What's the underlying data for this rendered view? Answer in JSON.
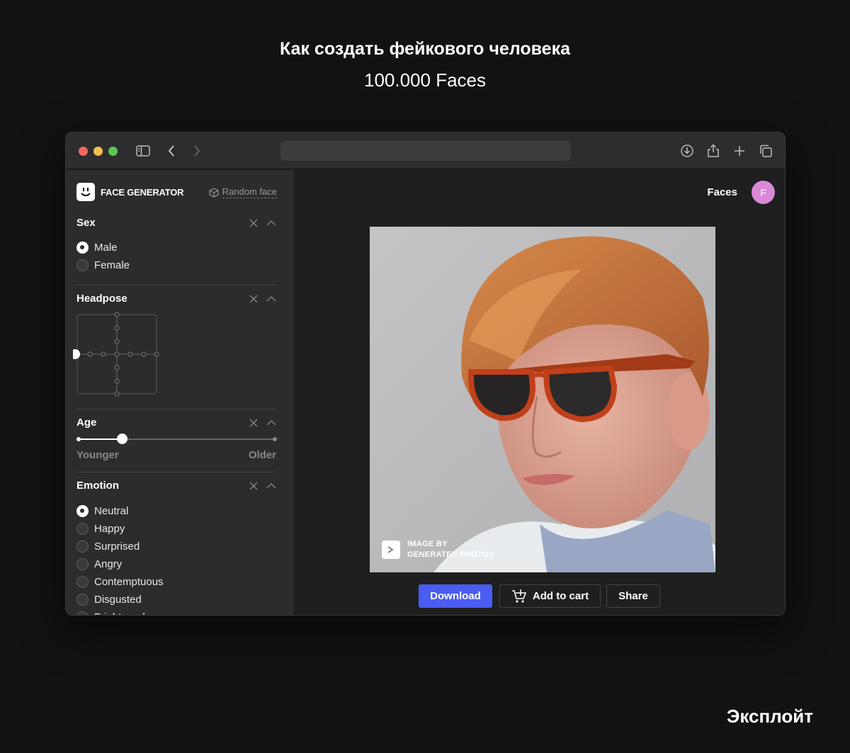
{
  "page": {
    "title": "Как создать фейкового человека",
    "subtitle": "100.000 Faces",
    "footer_brand": "Эксплойт"
  },
  "app": {
    "logo_text": "FACE GENERATOR",
    "random_face": "Random face",
    "nav_link": "Faces",
    "avatar_initial": "F"
  },
  "filters": {
    "sex": {
      "title": "Sex",
      "options": [
        "Male",
        "Female"
      ],
      "selected": "Male"
    },
    "headpose": {
      "title": "Headpose"
    },
    "age": {
      "title": "Age",
      "min_label": "Younger",
      "max_label": "Older",
      "value_fraction": 0.22
    },
    "emotion": {
      "title": "Emotion",
      "options": [
        "Neutral",
        "Happy",
        "Surprised",
        "Angry",
        "Contemptuous",
        "Disgusted",
        "Frightened"
      ],
      "selected": "Neutral"
    }
  },
  "photo": {
    "watermark_line1": "IMAGE BY",
    "watermark_line2": "GENERATED.PHOTOS"
  },
  "actions": {
    "download": "Download",
    "add_to_cart": "Add to cart",
    "share": "Share"
  },
  "colors": {
    "accent": "#4a5cf2",
    "avatar": "#d88ad6",
    "background": "#121212"
  }
}
